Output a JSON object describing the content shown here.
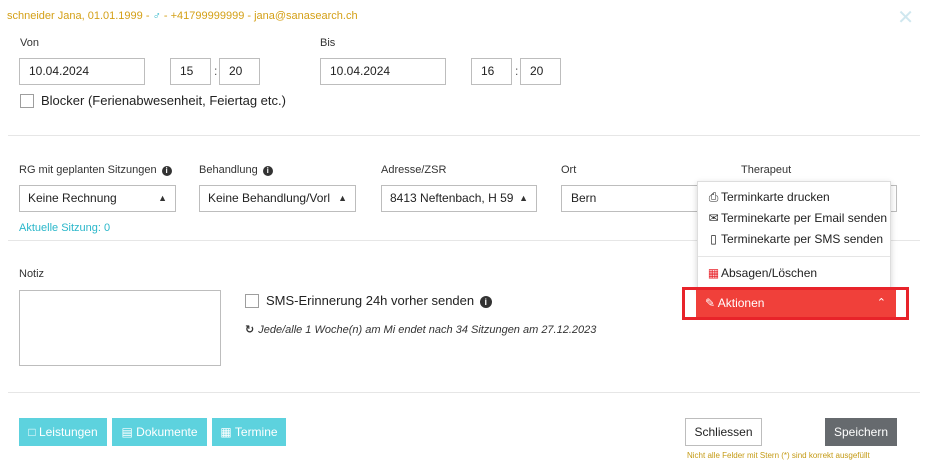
{
  "header": {
    "patient_name": "schneider Jana, 01.01.1999",
    "separator": " - ",
    "gender_symbol": "♂",
    "phone": "+41799999999",
    "email": "jana@sanasearch.ch",
    "close_symbol": "✕"
  },
  "von": {
    "label": "Von",
    "date": "10.04.2024",
    "hour": "15",
    "minute": "20",
    "colon": ":"
  },
  "bis": {
    "label": "Bis",
    "date": "10.04.2024",
    "hour": "16",
    "minute": "20",
    "colon": ":"
  },
  "blocker": {
    "label": "Blocker (Ferienabwesenheit, Feiertag etc.)",
    "checked": false
  },
  "fields": {
    "rg_label": "RG mit geplanten Sitzungen",
    "rg_value": "Keine Rechnung",
    "behandlung_label": "Behandlung",
    "behandlung_value": "Keine Behandlung/Vorl",
    "adresse_label": "Adresse/ZSR",
    "adresse_value": "8413 Neftenbach, H 59",
    "ort_label": "Ort",
    "ort_value": "Bern",
    "therapeut_label": "Therapeut"
  },
  "aktuelle_sitzung": "Aktuelle Sitzung: 0",
  "notiz": {
    "label": "Notiz",
    "value": ""
  },
  "sms": {
    "label": "SMS-Erinnerung 24h vorher senden",
    "checked": false
  },
  "recurrence": {
    "icon": "refresh-icon",
    "text": "Jede/alle 1 Woche(n) am Mi endet nach 34 Sitzungen am 27.12.2023"
  },
  "actions_menu": {
    "items": [
      {
        "icon": "print-icon",
        "label": "Terminkarte drucken"
      },
      {
        "icon": "envelope-icon",
        "label": "Terminekarte per Email senden"
      },
      {
        "icon": "mobile-icon",
        "label": "Terminekarte per SMS senden"
      },
      {
        "icon": "calendar-x-icon",
        "label": "Absagen/Löschen"
      }
    ],
    "button_label": "Aktionen",
    "button_color": "#f0403a",
    "highlight_color": "#e8232a"
  },
  "footer": {
    "leistungen": "Leistungen",
    "dokumente": "Dokumente",
    "termine": "Termine",
    "schliessen": "Schliessen",
    "speichern": "Speichern",
    "warning": "Nicht alle Felder mit Stern (*) sind korrekt ausgefüllt",
    "teal_color": "#5dd2de",
    "save_color": "#666a6e"
  }
}
